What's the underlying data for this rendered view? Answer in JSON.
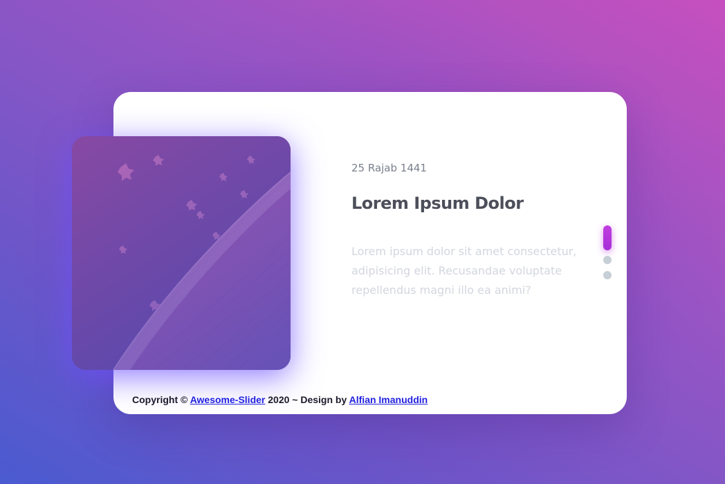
{
  "slide": {
    "date": "25 Rajab 1441",
    "title": "Lorem Ipsum Dolor",
    "text": "Lorem ipsum dolor sit amet consectetur, adipisicing elit. Recusandae voluptate repellendus magni illo ea animi?"
  },
  "pagination": {
    "count": 3,
    "active_index": 0
  },
  "footer": {
    "copyright_prefix": "Copyright ©",
    "project_link": "Awesome-Slider",
    "middle_text": "2020 ~ Design by",
    "author_link": "Alfian Imanuddin"
  },
  "colors": {
    "accent": "#b936dc",
    "dot_inactive": "#c6cfd6",
    "title": "#4c4f5a",
    "date": "#7a7f8c",
    "body_text": "#d3d6df"
  }
}
